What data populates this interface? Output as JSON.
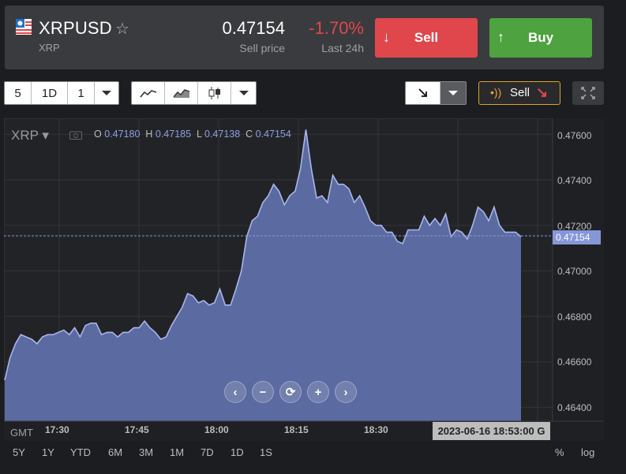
{
  "header": {
    "symbol": "XRPUSD",
    "subtitle": "XRP",
    "price": "0.47154",
    "price_label": "Sell price",
    "change": "-1.70%",
    "change_label": "Last 24h",
    "sell_label": "Sell",
    "buy_label": "Buy",
    "sell_color": "#e0474c",
    "buy_color": "#4ea23f"
  },
  "toolbar": {
    "range_a": "5",
    "range_b": "1D",
    "range_c": "1",
    "alert_label": "Sell"
  },
  "chart": {
    "instrument": "XRP",
    "ohlc": {
      "o_label": "O",
      "o": "0.47180",
      "h_label": "H",
      "h": "0.47185",
      "l_label": "L",
      "l": "0.47138",
      "c_label": "C",
      "c": "0.47154"
    },
    "y_ticks": [
      "0.47600",
      "0.47400",
      "0.47200",
      "0.47000",
      "0.46800",
      "0.46600",
      "0.46400"
    ],
    "x_ticks": [
      "17:30",
      "17:45",
      "18:00",
      "18:15",
      "18:30"
    ],
    "tz": "GMT",
    "current_value": "0.47154",
    "cursor_time": "2023-06-16 18:53:00 G"
  },
  "chart_data": {
    "type": "area",
    "ylim": [
      0.4634,
      0.4767
    ],
    "series": [
      {
        "values": [
          0.4652,
          0.4662,
          0.4668,
          0.4672,
          0.4671,
          0.467,
          0.4668,
          0.4671,
          0.4672,
          0.4672,
          0.4673,
          0.4674,
          0.4672,
          0.4675,
          0.4671,
          0.4676,
          0.4677,
          0.4677,
          0.4672,
          0.4673,
          0.4673,
          0.4671,
          0.4673,
          0.4673,
          0.4675,
          0.4675,
          0.4678,
          0.4675,
          0.4673,
          0.467,
          0.4671,
          0.4676,
          0.468,
          0.4684,
          0.469,
          0.4689,
          0.4686,
          0.4687,
          0.4685,
          0.4686,
          0.4692,
          0.4685,
          0.4685,
          0.4692,
          0.47,
          0.4715,
          0.4722,
          0.4724,
          0.473,
          0.4733,
          0.4738,
          0.4735,
          0.4729,
          0.4733,
          0.4735,
          0.4745,
          0.4762,
          0.4745,
          0.4732,
          0.4733,
          0.473,
          0.4742,
          0.4738,
          0.4738,
          0.4736,
          0.473,
          0.4733,
          0.4728,
          0.4722,
          0.472,
          0.472,
          0.4717,
          0.4717,
          0.4713,
          0.4712,
          0.4718,
          0.4718,
          0.4718,
          0.4724,
          0.472,
          0.4723,
          0.472,
          0.4725,
          0.4715,
          0.4718,
          0.4717,
          0.4714,
          0.472,
          0.4728,
          0.4726,
          0.4722,
          0.4728,
          0.472,
          0.4717,
          0.4717,
          0.4717,
          0.4715
        ]
      }
    ]
  },
  "nav": {
    "prev": "‹",
    "zoom_out": "−",
    "reset": "⟳",
    "zoom_in": "+",
    "next": "›"
  },
  "ranges": [
    "5Y",
    "1Y",
    "YTD",
    "6M",
    "3M",
    "1M",
    "7D",
    "1D",
    "1S"
  ],
  "scale_opts": {
    "pct": "%",
    "log": "log"
  }
}
